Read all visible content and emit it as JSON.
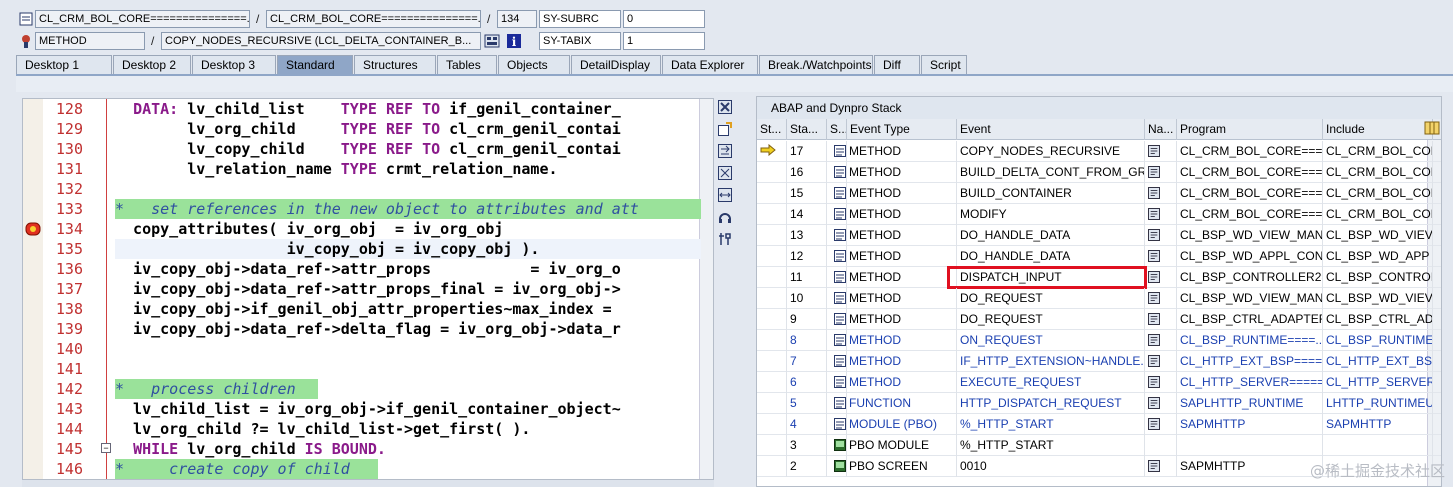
{
  "header": {
    "row1": {
      "program": "CL_CRM_BOL_CORE===============...",
      "include": "CL_CRM_BOL_CORE===============...",
      "line": "134",
      "var_name": "SY-SUBRC",
      "var_value": "0"
    },
    "row2": {
      "event_type": "METHOD",
      "event": "COPY_NODES_RECURSIVE (LCL_DELTA_CONTAINER_B...",
      "var_name": "SY-TABIX",
      "var_value": "1"
    },
    "separator": "/"
  },
  "tabs": [
    "Desktop 1",
    "Desktop 2",
    "Desktop 3",
    "Standard",
    "Structures",
    "Tables",
    "Objects",
    "DetailDisplay",
    "Data Explorer",
    "Break./Watchpoints",
    "Diff",
    "Script"
  ],
  "active_tab": "Standard",
  "editor": {
    "lines": [
      {
        "no": "128",
        "code": "  DATA: lv_child_list    TYPE REF TO if_genil_container_"
      },
      {
        "no": "129",
        "code": "        lv_org_child     TYPE REF TO cl_crm_genil_contai"
      },
      {
        "no": "130",
        "code": "        lv_copy_child    TYPE REF TO cl_crm_genil_contai"
      },
      {
        "no": "131",
        "code": "        lv_relation_name TYPE crmt_relation_name."
      },
      {
        "no": "132",
        "code": ""
      },
      {
        "no": "133",
        "code": "*   set references in the new object to attributes and att"
      },
      {
        "no": "134",
        "code": "  copy_attributes( iv_org_obj  = iv_org_obj"
      },
      {
        "no": "135",
        "code": "                   iv_copy_obj = iv_copy_obj )."
      },
      {
        "no": "136",
        "code": "  iv_copy_obj->data_ref->attr_props           = iv_org_o"
      },
      {
        "no": "137",
        "code": "  iv_copy_obj->data_ref->attr_props_final = iv_org_obj->"
      },
      {
        "no": "138",
        "code": "  iv_copy_obj->if_genil_obj_attr_properties~max_index = "
      },
      {
        "no": "139",
        "code": "  iv_copy_obj->data_ref->delta_flag = iv_org_obj->data_r"
      },
      {
        "no": "140",
        "code": ""
      },
      {
        "no": "141",
        "code": ""
      },
      {
        "no": "142",
        "code": "*   process children"
      },
      {
        "no": "143",
        "code": "  lv_child_list = iv_org_obj->if_genil_container_object~"
      },
      {
        "no": "144",
        "code": "  lv_org_child ?= lv_child_list->get_first( )."
      },
      {
        "no": "145",
        "code": "  WHILE lv_org_child IS BOUND."
      },
      {
        "no": "146",
        "code": "*     create copy of child"
      }
    ]
  },
  "stack": {
    "title": "ABAP and Dynpro Stack",
    "columns": [
      "St...",
      "Sta...",
      "S...",
      "Event Type",
      "Event",
      "Na...",
      "Program",
      "Include"
    ],
    "rows": [
      {
        "status": "arrow",
        "level": "17",
        "type": "METHOD",
        "event": "COPY_NODES_RECURSIVE",
        "program": "CL_CRM_BOL_CORE===...",
        "include": "CL_CRM_BOL_COR",
        "blue": false
      },
      {
        "status": "",
        "level": "16",
        "type": "METHOD",
        "event": "BUILD_DELTA_CONT_FROM_GR...",
        "program": "CL_CRM_BOL_CORE===...",
        "include": "CL_CRM_BOL_COR",
        "blue": false
      },
      {
        "status": "",
        "level": "15",
        "type": "METHOD",
        "event": "BUILD_CONTAINER",
        "program": "CL_CRM_BOL_CORE===...",
        "include": "CL_CRM_BOL_COR",
        "blue": false
      },
      {
        "status": "",
        "level": "14",
        "type": "METHOD",
        "event": "MODIFY",
        "program": "CL_CRM_BOL_CORE===...",
        "include": "CL_CRM_BOL_COR",
        "blue": false
      },
      {
        "status": "",
        "level": "13",
        "type": "METHOD",
        "event": "DO_HANDLE_DATA",
        "program": "CL_BSP_WD_VIEW_MAN...",
        "include": "CL_BSP_WD_VIEV",
        "blue": false
      },
      {
        "status": "",
        "level": "12",
        "type": "METHOD",
        "event": "DO_HANDLE_DATA",
        "program": "CL_BSP_WD_APPL_CON...",
        "include": "CL_BSP_WD_APP",
        "blue": false
      },
      {
        "status": "",
        "level": "11",
        "type": "METHOD",
        "event": "DISPATCH_INPUT",
        "program": "CL_BSP_CONTROLLER2=...",
        "include": "CL_BSP_CONTROI",
        "blue": false
      },
      {
        "status": "",
        "level": "10",
        "type": "METHOD",
        "event": "DO_REQUEST",
        "program": "CL_BSP_WD_VIEW_MAN...",
        "include": "CL_BSP_WD_VIEV",
        "blue": false
      },
      {
        "status": "",
        "level": "9",
        "type": "METHOD",
        "event": "DO_REQUEST",
        "program": "CL_BSP_CTRL_ADAPTER...",
        "include": "CL_BSP_CTRL_AD",
        "blue": false
      },
      {
        "status": "",
        "level": "8",
        "type": "METHOD",
        "event": "ON_REQUEST",
        "program": "CL_BSP_RUNTIME====...",
        "include": "CL_BSP_RUNTIME",
        "blue": true
      },
      {
        "status": "",
        "level": "7",
        "type": "METHOD",
        "event": "IF_HTTP_EXTENSION~HANDLE...",
        "program": "CL_HTTP_EXT_BSP====...",
        "include": "CL_HTTP_EXT_BS",
        "blue": true
      },
      {
        "status": "",
        "level": "6",
        "type": "METHOD",
        "event": "EXECUTE_REQUEST",
        "program": "CL_HTTP_SERVER=====...",
        "include": "CL_HTTP_SERVER",
        "blue": true
      },
      {
        "status": "",
        "level": "5",
        "type": "FUNCTION",
        "event": "HTTP_DISPATCH_REQUEST",
        "program": "SAPLHTTP_RUNTIME",
        "include": "LHTTP_RUNTIMEU",
        "blue": true
      },
      {
        "status": "",
        "level": "4",
        "type": "MODULE (PBO)",
        "event": "%_HTTP_START",
        "program": "SAPMHTTP",
        "include": "SAPMHTTP",
        "blue": true
      },
      {
        "status": "",
        "level": "3",
        "type": "PBO MODULE",
        "event": "%_HTTP_START",
        "program": "",
        "include": "",
        "blue": false
      },
      {
        "status": "",
        "level": "2",
        "type": "PBO SCREEN",
        "event": "0010",
        "program": "SAPMHTTP",
        "include": "",
        "blue": false
      }
    ],
    "highlighted_event": "DISPATCH_INPUT"
  },
  "watermark": "@稀土掘金技术社区",
  "colors": {
    "active_tab": "#8fa6c7",
    "comment_bg": "#9ae29a",
    "keyword": "#8a1a8a",
    "highlight_box": "#e01020",
    "line_numbers": "#c03030"
  }
}
